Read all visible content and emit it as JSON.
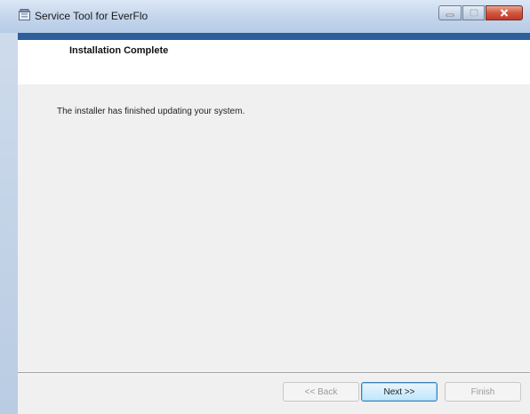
{
  "window": {
    "title": "Service Tool for EverFlo",
    "controls": {
      "minimize": "minimize",
      "maximize": "maximize",
      "close": "close"
    }
  },
  "header": {
    "title": "Installation Complete"
  },
  "content": {
    "message": "The installer has finished updating your system."
  },
  "footer": {
    "back_label": "<< Back",
    "next_label": "Next >>",
    "finish_label": "Finish"
  },
  "colors": {
    "accent_strip": "#2d5f9c",
    "content_bg": "#f0f0f0",
    "close_button": "#c0392b"
  }
}
